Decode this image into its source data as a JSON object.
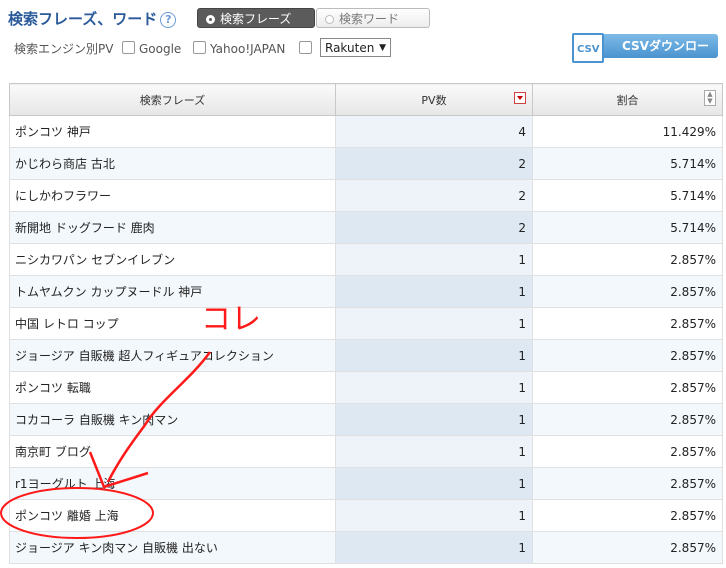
{
  "header": {
    "title": "検索フレーズ、ワード",
    "help_icon": "?",
    "tab_phrase": "検索フレーズ",
    "tab_word": "検索ワード"
  },
  "filters": {
    "label": "検索エンジン別PV",
    "google": "Google",
    "yahoo": "Yahoo!JAPAN",
    "select_value": "Rakuten",
    "select_caret": "▼"
  },
  "csv": {
    "icon_text": "CSV",
    "label": "CSVダウンロード"
  },
  "table": {
    "headers": [
      "検索フレーズ",
      "PV数",
      "割合"
    ],
    "rows": [
      {
        "phrase": "ポンコツ 神戸",
        "pv": "4",
        "ratio": "11.429%"
      },
      {
        "phrase": "かじわら商店 古北",
        "pv": "2",
        "ratio": "5.714%"
      },
      {
        "phrase": "にしかわフラワー",
        "pv": "2",
        "ratio": "5.714%"
      },
      {
        "phrase": "新開地 ドッグフード 鹿肉",
        "pv": "2",
        "ratio": "5.714%"
      },
      {
        "phrase": "ニシカワパン セブンイレブン",
        "pv": "1",
        "ratio": "2.857%"
      },
      {
        "phrase": "トムヤムクン カップヌードル 神戸",
        "pv": "1",
        "ratio": "2.857%"
      },
      {
        "phrase": "中国 レトロ コップ",
        "pv": "1",
        "ratio": "2.857%"
      },
      {
        "phrase": "ジョージア 自販機 超人フィギュアコレクション",
        "pv": "1",
        "ratio": "2.857%"
      },
      {
        "phrase": "ポンコツ 転職",
        "pv": "1",
        "ratio": "2.857%"
      },
      {
        "phrase": "コカコーラ 自販機 キン肉マン",
        "pv": "1",
        "ratio": "2.857%"
      },
      {
        "phrase": "南京町 ブログ",
        "pv": "1",
        "ratio": "2.857%"
      },
      {
        "phrase": "r1ヨーグルト 上海",
        "pv": "1",
        "ratio": "2.857%"
      },
      {
        "phrase": "ポンコツ 離婚 上海",
        "pv": "1",
        "ratio": "2.857%"
      },
      {
        "phrase": "ジョージア キン肉マン 自販機 出ない",
        "pv": "1",
        "ratio": "2.857%"
      }
    ]
  },
  "annotation": {
    "text": "コレ",
    "color": "#ff1a1a"
  }
}
